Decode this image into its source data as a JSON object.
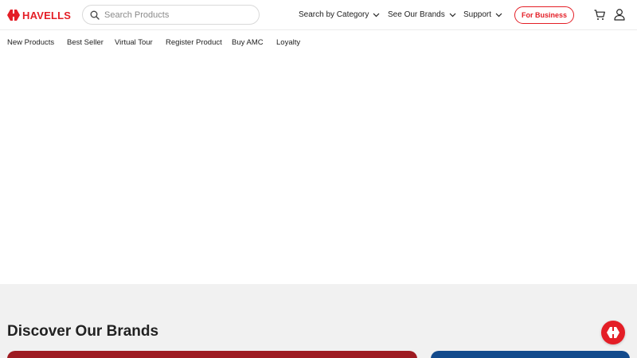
{
  "header": {
    "logo_text": "HAVELLS",
    "brand_color": "#e41e26",
    "search": {
      "placeholder": "Search Products",
      "value": "",
      "icon": "search-icon"
    },
    "nav": [
      {
        "label": "Search by Category",
        "icon": "chevron-down-icon"
      },
      {
        "label": "See Our Brands",
        "icon": "chevron-down-icon"
      },
      {
        "label": "Support",
        "icon": "chevron-down-icon"
      }
    ],
    "business_button": "For Business",
    "cart_icon": "cart-icon",
    "user_icon": "user-icon"
  },
  "subnav": [
    {
      "label": "New Products"
    },
    {
      "label": "Best Seller"
    },
    {
      "label": "Virtual Tour"
    },
    {
      "label": "Register Product"
    },
    {
      "label": "Buy AMC"
    },
    {
      "label": "Loyalty"
    }
  ],
  "brands": {
    "title": "Discover Our Brands",
    "card_colors": [
      "#9e1b22",
      "#124a8c"
    ]
  },
  "chat": {
    "icon": "havells-chat-icon"
  }
}
